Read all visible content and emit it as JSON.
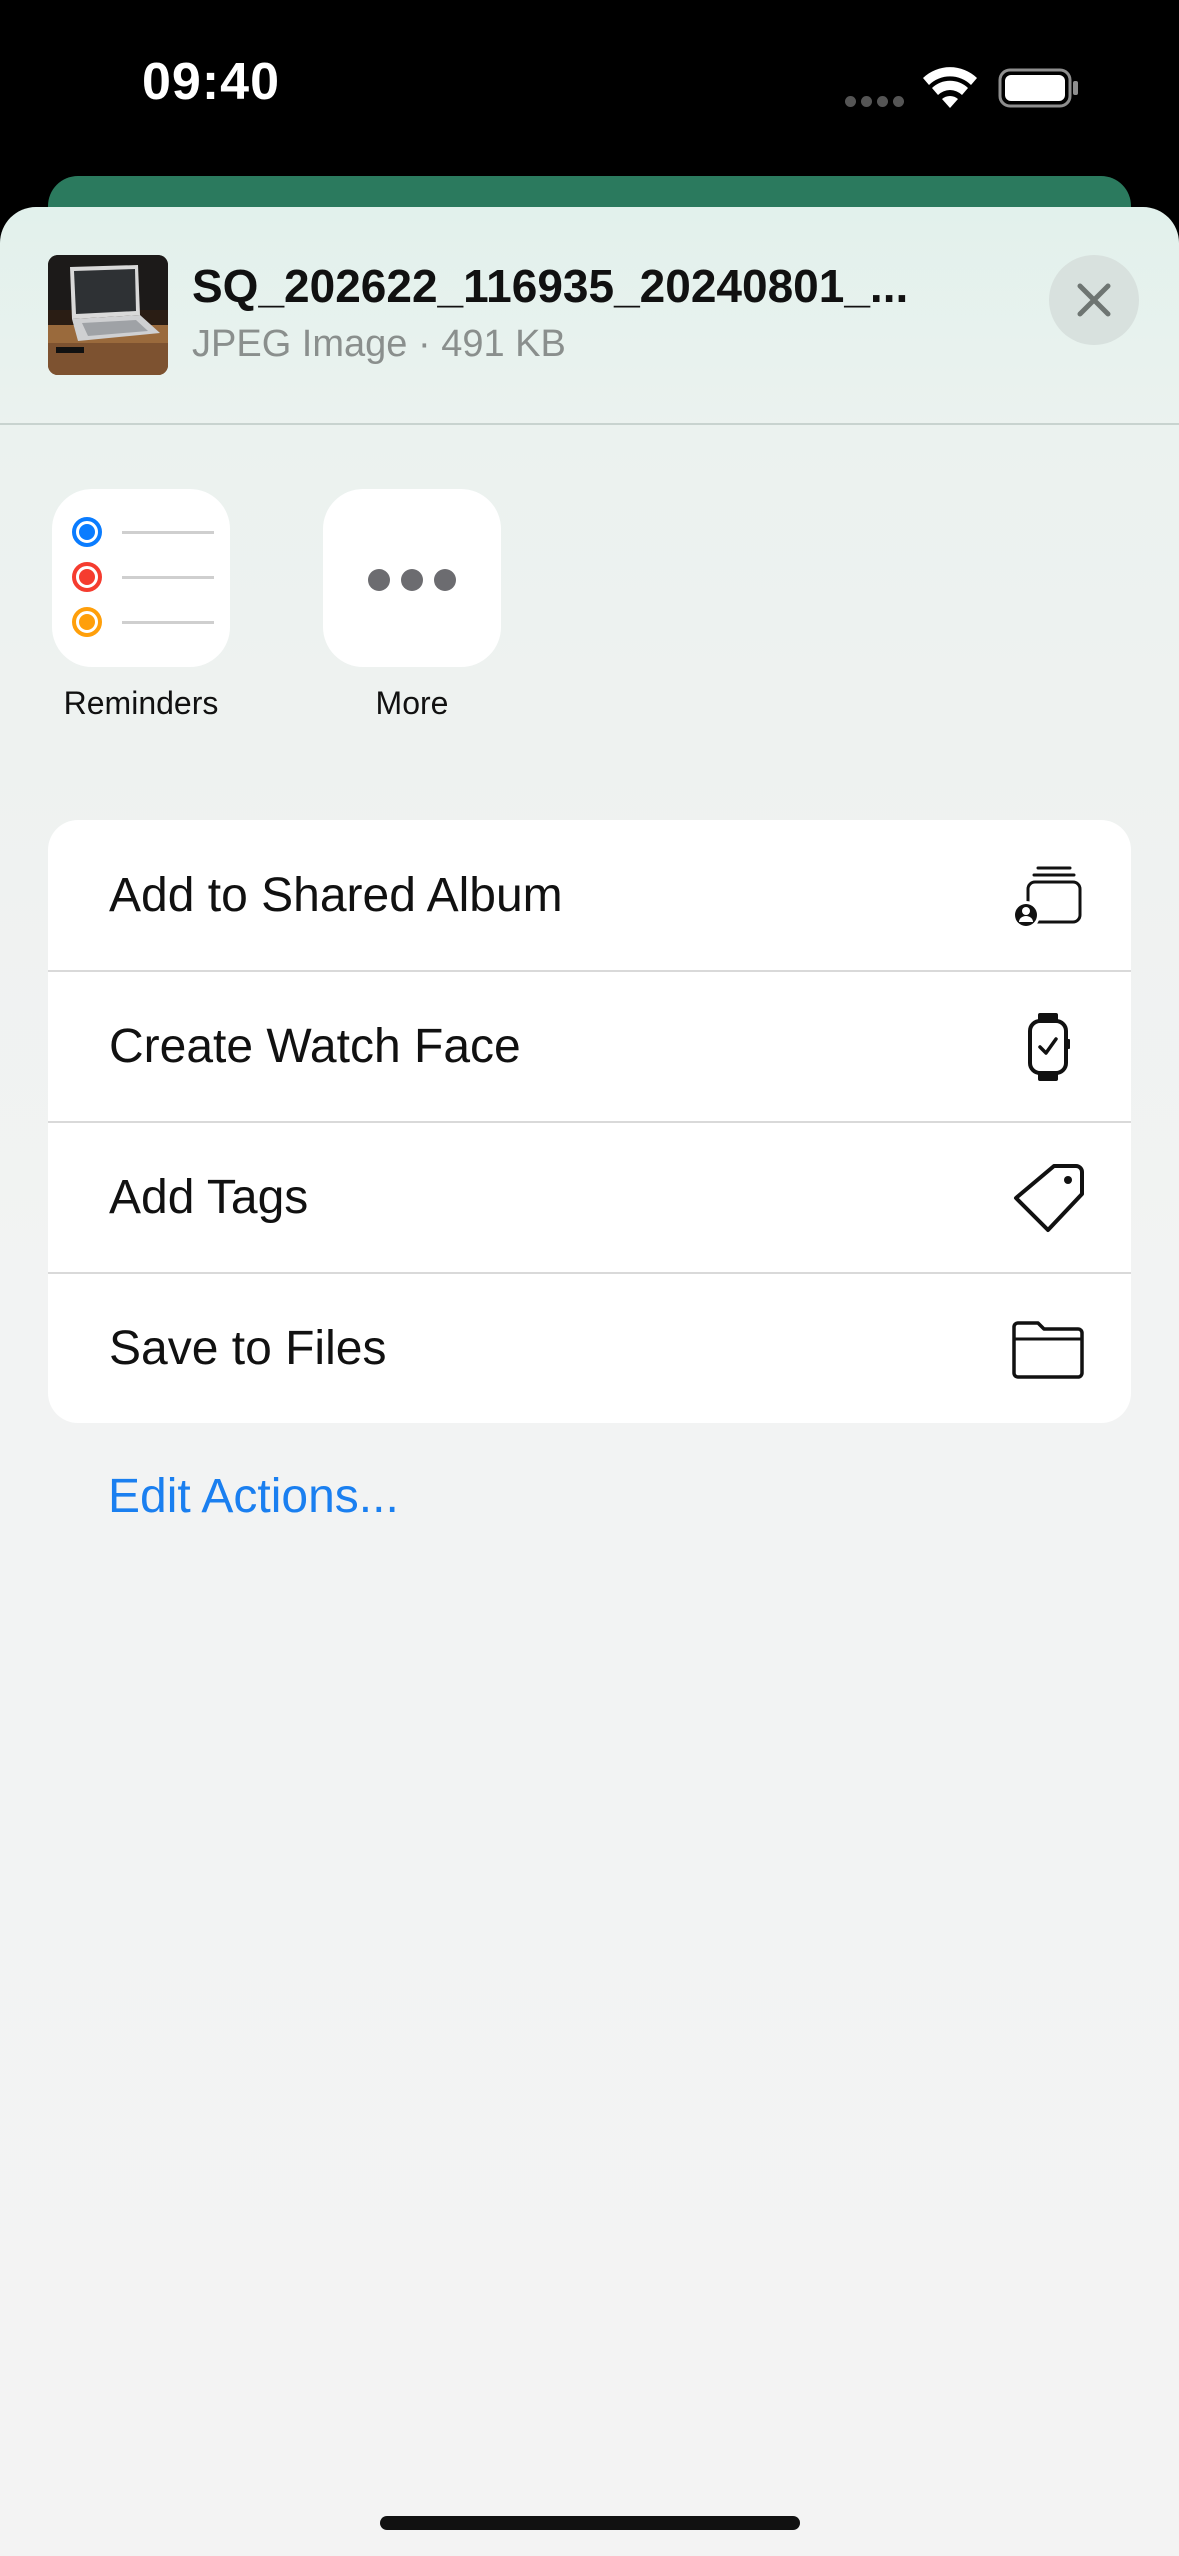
{
  "status_bar": {
    "time": "09:40",
    "wifi_icon": "wifi-icon",
    "battery_icon": "battery-icon"
  },
  "share_sheet": {
    "file": {
      "title": "SQ_202622_116935_20240801_...",
      "meta": "JPEG Image · 491 KB",
      "thumbnail": "laptop-photo-thumbnail"
    },
    "close_icon": "close-icon",
    "apps": [
      {
        "label": "Reminders",
        "icon": "reminders-app-icon"
      },
      {
        "label": "More",
        "icon": "more-dots-icon"
      }
    ],
    "actions": [
      {
        "label": "Add to Shared Album",
        "icon": "shared-album-icon"
      },
      {
        "label": "Create Watch Face",
        "icon": "watch-icon"
      },
      {
        "label": "Add Tags",
        "icon": "tag-icon"
      },
      {
        "label": "Save to Files",
        "icon": "folder-icon"
      }
    ],
    "edit_actions_label": "Edit Actions..."
  },
  "colors": {
    "accent": "#1a7ff0",
    "background_card": "#2b7a5e",
    "reminder_blue": "#0a7cff",
    "reminder_red": "#f53c2f",
    "reminder_orange": "#ff9f0a"
  }
}
